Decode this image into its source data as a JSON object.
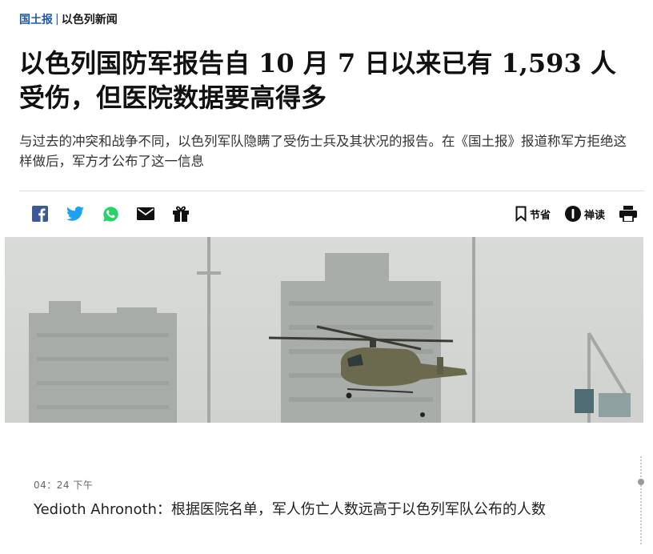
{
  "breadcrumb": {
    "brand": "国土报",
    "separator": "|",
    "section": "以色列新闻"
  },
  "article": {
    "headline": "以色列国防军报告自 10 月 7 日以来已有 1,593 人受伤，但医院数据要高得多",
    "subheadline": "与过去的冲突和战争不同，以色列军队隐瞒了受伤士兵及其状况的报告。在《国土报》报道称军方拒绝这样做后，军方才公布了这一信息"
  },
  "toolbar": {
    "share_icons": [
      "facebook-icon",
      "twitter-icon",
      "whatsapp-icon",
      "email-icon",
      "gift-icon"
    ],
    "save_label": "节省",
    "reader_label": "禅读",
    "print_icon": "printer-icon"
  },
  "colors": {
    "brand_blue": "#1f5aa8",
    "facebook": "#3b5998",
    "twitter": "#1da1f2",
    "whatsapp": "#25d366",
    "text_dark": "#111111"
  },
  "live_update": {
    "time": "04：24 下午",
    "text": "Yedioth Ahronoth：根据医院名单，军人伤亡人数远高于以色列军队公布的人数"
  }
}
